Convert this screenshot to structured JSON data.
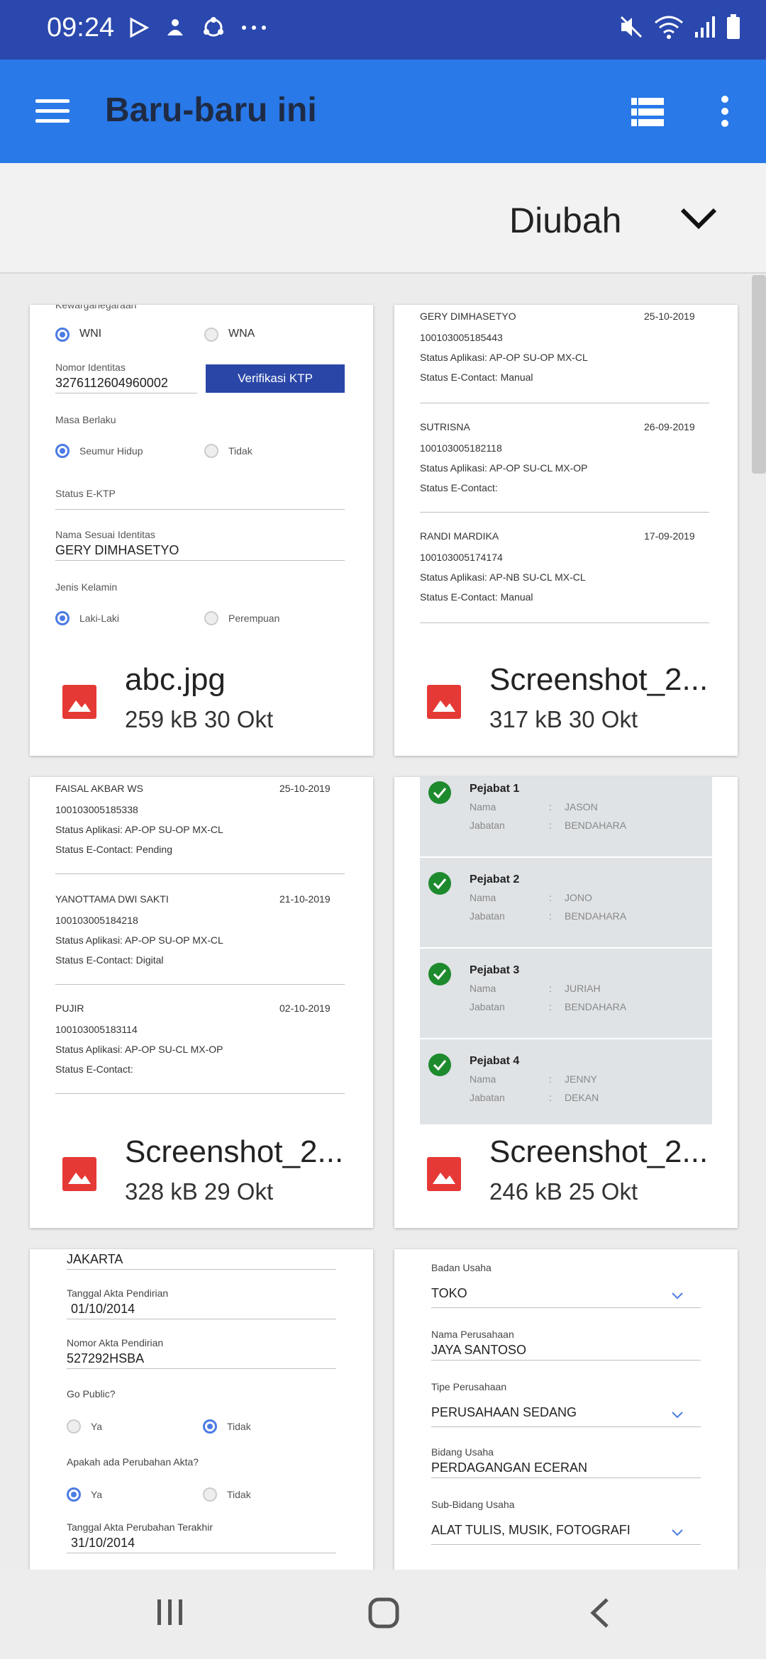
{
  "status": {
    "time": "09:24"
  },
  "appbar": {
    "title": "Baru-baru ini"
  },
  "sort": {
    "label": "Diubah"
  },
  "cards": [
    {
      "name": "abc.jpg",
      "meta": "259 kB 30 Okt"
    },
    {
      "name": "Screenshot_2...",
      "meta": "317 kB 30 Okt"
    },
    {
      "name": "Screenshot_2...",
      "meta": "328 kB 29 Okt"
    },
    {
      "name": "Screenshot_2...",
      "meta": "246 kB 25 Okt"
    }
  ],
  "thumb1": {
    "kewarga": "Kewarganegaraan",
    "wni": "WNI",
    "wna": "WNA",
    "nomor_label": "Nomor Identitas",
    "nomor": "3276112604960002",
    "btn": "Verifikasi KTP",
    "masa": "Masa Berlaku",
    "seumur": "Seumur Hidup",
    "tidak": "Tidak",
    "status_ektp": "Status E-KTP",
    "nama_label": "Nama Sesuai Identitas",
    "nama": "GERY DIMHASETYO",
    "jenis": "Jenis Kelamin",
    "laki": "Laki-Laki",
    "perempuan": "Perempuan"
  },
  "thumb2": [
    {
      "name": "GERY DIMHASETYO",
      "date": "25-10-2019",
      "id": "100103005185443",
      "app": "Status Aplikasi: AP-OP SU-OP MX-CL",
      "ec": "Status E-Contact: Manual"
    },
    {
      "name": "SUTRISNA",
      "date": "26-09-2019",
      "id": "100103005182118",
      "app": "Status Aplikasi: AP-OP SU-CL MX-OP",
      "ec": "Status E-Contact:"
    },
    {
      "name": "RANDI MARDIKA",
      "date": "17-09-2019",
      "id": "100103005174174",
      "app": "Status Aplikasi: AP-NB SU-CL MX-CL",
      "ec": "Status E-Contact: Manual"
    }
  ],
  "thumb3": [
    {
      "name": "FAISAL AKBAR WS",
      "date": "25-10-2019",
      "id": "100103005185338",
      "app": "Status Aplikasi: AP-OP SU-OP MX-CL",
      "ec": "Status E-Contact: Pending"
    },
    {
      "name": "YANOTTAMA DWI SAKTI",
      "date": "21-10-2019",
      "id": "100103005184218",
      "app": "Status Aplikasi: AP-OP SU-OP MX-CL",
      "ec": "Status E-Contact: Digital"
    },
    {
      "name": "PUJIR",
      "date": "02-10-2019",
      "id": "100103005183114",
      "app": "Status Aplikasi: AP-OP SU-CL MX-OP",
      "ec": "Status E-Contact:"
    }
  ],
  "thumb4": {
    "nama_label": "Nama",
    "jabatan_label": "Jabatan",
    "sep": ":",
    "items": [
      {
        "title": "Pejabat 1",
        "nama": "JASON",
        "jabatan": "BENDAHARA"
      },
      {
        "title": "Pejabat 2",
        "nama": "JONO",
        "jabatan": "BENDAHARA"
      },
      {
        "title": "Pejabat 3",
        "nama": "JURIAH",
        "jabatan": "BENDAHARA"
      },
      {
        "title": "Pejabat 4",
        "nama": "JENNY",
        "jabatan": "DEKAN"
      }
    ]
  },
  "thumb5": {
    "kota": "JAKARTA",
    "tgl_label": "Tanggal Akta Pendirian",
    "tgl": "01/10/2014",
    "nomor_label": "Nomor Akta Pendirian",
    "nomor": "527292HSBA",
    "gopublic": "Go Public?",
    "ya": "Ya",
    "tidak": "Tidak",
    "perubahan": "Apakah ada Perubahan Akta?",
    "tgl2_label": "Tanggal Akta Perubahan Terakhir",
    "tgl2": "31/10/2014"
  },
  "thumb6": {
    "badan_label": "Badan Usaha",
    "badan": "TOKO",
    "nama_label": "Nama Perusahaan",
    "nama": "JAYA SANTOSO",
    "tipe_label": "Tipe Perusahaan",
    "tipe": "PERUSAHAAN SEDANG",
    "bidang_label": "Bidang Usaha",
    "bidang": "PERDAGANGAN ECERAN",
    "sub_label": "Sub-Bidang Usaha",
    "sub": "ALAT TULIS, MUSIK, FOTOGRAFI"
  }
}
